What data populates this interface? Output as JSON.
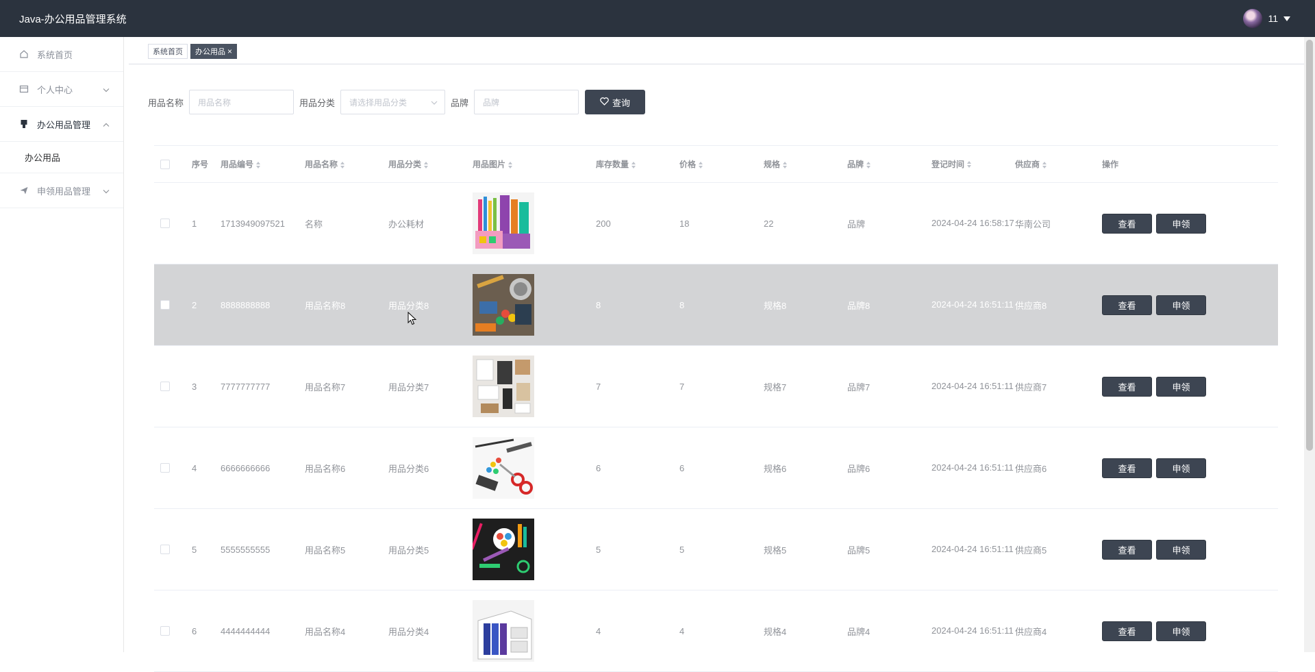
{
  "app": {
    "title": "Java-办公用品管理系统",
    "user": "11"
  },
  "sidebar": {
    "items": [
      {
        "label": "系统首页",
        "icon": "home-icon"
      },
      {
        "label": "个人中心",
        "icon": "card-icon"
      },
      {
        "label": "办公用品管理",
        "icon": "pin-icon"
      },
      {
        "label": "办公用品"
      },
      {
        "label": "申领用品管理",
        "icon": "send-icon"
      }
    ]
  },
  "tabs": [
    {
      "label": "系统首页"
    },
    {
      "label": "办公用品",
      "close": "×"
    }
  ],
  "search": {
    "name_label": "用品名称",
    "name_placeholder": "用品名称",
    "category_label": "用品分类",
    "category_placeholder": "请选择用品分类",
    "brand_label": "品牌",
    "brand_placeholder": "品牌",
    "query_button": "查询"
  },
  "table": {
    "headers": [
      "序号",
      "用品编号",
      "用品名称",
      "用品分类",
      "用品图片",
      "库存数量",
      "价格",
      "规格",
      "品牌",
      "登记时间",
      "供应商",
      "操作"
    ],
    "view_label": "查看",
    "apply_label": "申领",
    "rows": [
      {
        "idx": "1",
        "code": "1713949097521",
        "name": "名称",
        "category": "办公耗材",
        "stock": "200",
        "price": "18",
        "spec": "22",
        "brand": "品牌",
        "time": "2024-04-24 16:58:17",
        "supplier": "华南公司",
        "image": "pens-cup"
      },
      {
        "idx": "2",
        "code": "8888888888",
        "name": "用品名称8",
        "category": "用品分类8",
        "stock": "8",
        "price": "8",
        "spec": "规格8",
        "brand": "品牌8",
        "time": "2024-04-24 16:51:11",
        "supplier": "供应商8",
        "image": "desk-supplies"
      },
      {
        "idx": "3",
        "code": "7777777777",
        "name": "用品名称7",
        "category": "用品分类7",
        "stock": "7",
        "price": "7",
        "spec": "规格7",
        "brand": "品牌7",
        "time": "2024-04-24 16:51:11",
        "supplier": "供应商7",
        "image": "flatlay-white"
      },
      {
        "idx": "4",
        "code": "6666666666",
        "name": "用品名称6",
        "category": "用品分类6",
        "stock": "6",
        "price": "6",
        "spec": "规格6",
        "brand": "品牌6",
        "time": "2024-04-24 16:51:11",
        "supplier": "供应商6",
        "image": "scissors-pins"
      },
      {
        "idx": "5",
        "code": "5555555555",
        "name": "用品名称5",
        "category": "用品分类5",
        "stock": "5",
        "price": "5",
        "spec": "规格5",
        "brand": "品牌5",
        "time": "2024-04-24 16:51:11",
        "supplier": "供应商5",
        "image": "colorful-dark"
      },
      {
        "idx": "6",
        "code": "4444444444",
        "name": "用品名称4",
        "category": "用品分类4",
        "stock": "4",
        "price": "4",
        "spec": "规格4",
        "brand": "品牌4",
        "time": "2024-04-24 16:51:11",
        "supplier": "供应商4",
        "image": "file-organizer"
      }
    ]
  },
  "colors": {
    "topbar": "#2b333e",
    "button": "#3d4552",
    "hover_row": "#d3d4d6"
  }
}
